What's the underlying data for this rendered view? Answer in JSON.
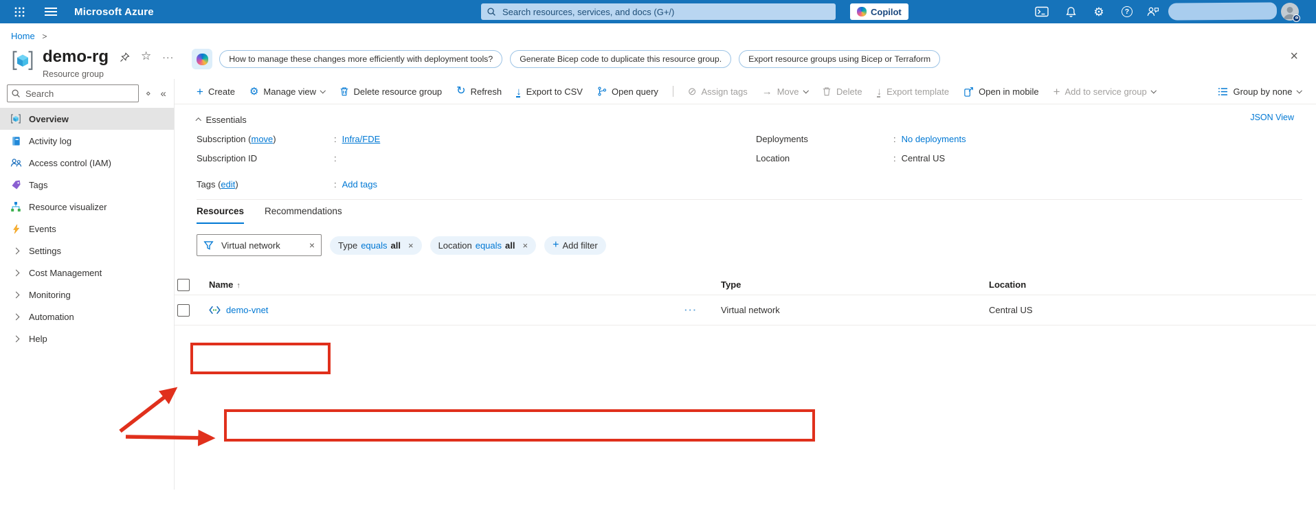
{
  "colors": {
    "topbar_blue": "#1673ba",
    "accent_blue": "#0078d4",
    "annotation_red": "#e0301c",
    "search_pill_blue": "#b9d6f1",
    "filter_pill_bg": "#eaf3fb"
  },
  "icons": {
    "close": "×",
    "star": "☆",
    "ellipsis": "···",
    "gear": "⚙",
    "refresh": "↻",
    "blocked": "⊘",
    "arrow_right": "→",
    "arrow_down": "↓",
    "plus": "+",
    "collapse": "«",
    "diamond": "⋄",
    "help": "?",
    "dismiss": "×"
  },
  "topbar": {
    "brand": "Microsoft Azure",
    "search_placeholder": "Search resources, services, and docs (G+/)",
    "copilot_label": "Copilot"
  },
  "breadcrumb": {
    "home": "Home",
    "separator": ">"
  },
  "page_header": {
    "title": "demo-rg",
    "subtitle": "Resource group",
    "suggestions": [
      "How to manage these changes more efficiently with deployment tools?",
      "Generate Bicep code to duplicate this resource group.",
      "Export resource groups using Bicep or Terraform"
    ]
  },
  "sidebar": {
    "search_placeholder": "Search",
    "items": [
      {
        "label": "Overview"
      },
      {
        "label": "Activity log"
      },
      {
        "label": "Access control (IAM)"
      },
      {
        "label": "Tags"
      },
      {
        "label": "Resource visualizer"
      },
      {
        "label": "Events"
      },
      {
        "label": "Settings"
      },
      {
        "label": "Cost Management"
      },
      {
        "label": "Monitoring"
      },
      {
        "label": "Automation"
      },
      {
        "label": "Help"
      }
    ]
  },
  "toolbar": {
    "items": [
      {
        "label": "Create"
      },
      {
        "label": "Manage view"
      },
      {
        "label": "Delete resource group"
      },
      {
        "label": "Refresh"
      },
      {
        "label": "Export to CSV"
      },
      {
        "label": "Open query"
      },
      {
        "label": "Assign tags"
      },
      {
        "label": "Move"
      },
      {
        "label": "Delete"
      },
      {
        "label": "Export template"
      },
      {
        "label": "Open in mobile"
      },
      {
        "label": "Add to service group"
      }
    ],
    "group_by_label": "Group by none"
  },
  "essentials": {
    "title": "Essentials",
    "json_view_label": "JSON View",
    "fields_left": [
      {
        "label_prefix": "Subscription (",
        "label_link": "move",
        "label_suffix": ")",
        "value": "Infra/FDE"
      },
      {
        "label_prefix": "Subscription ID",
        "label_link": "",
        "label_suffix": "",
        "value": ""
      },
      {
        "label_prefix": "Tags (",
        "label_link": "edit",
        "label_suffix": ")",
        "value": "Add tags"
      }
    ],
    "fields_right": [
      {
        "label": "Deployments",
        "value": "No deployments"
      },
      {
        "label": "Location",
        "value": "Central US"
      }
    ]
  },
  "tabs": [
    {
      "label": "Resources"
    },
    {
      "label": "Recommendations"
    }
  ],
  "filters": {
    "filter_input_value": "Virtual network",
    "chips": [
      {
        "field": "Type",
        "op": "equals",
        "value": "all"
      },
      {
        "field": "Location",
        "op": "equals",
        "value": "all"
      }
    ],
    "add_filter_label": "Add filter"
  },
  "table": {
    "sort_indicator": "↑",
    "columns": [
      {
        "label": "Name"
      },
      {
        "label": "Type"
      },
      {
        "label": "Location"
      }
    ],
    "rows": [
      {
        "name": "demo-vnet",
        "type": "Virtual network",
        "location": "Central US"
      }
    ]
  }
}
